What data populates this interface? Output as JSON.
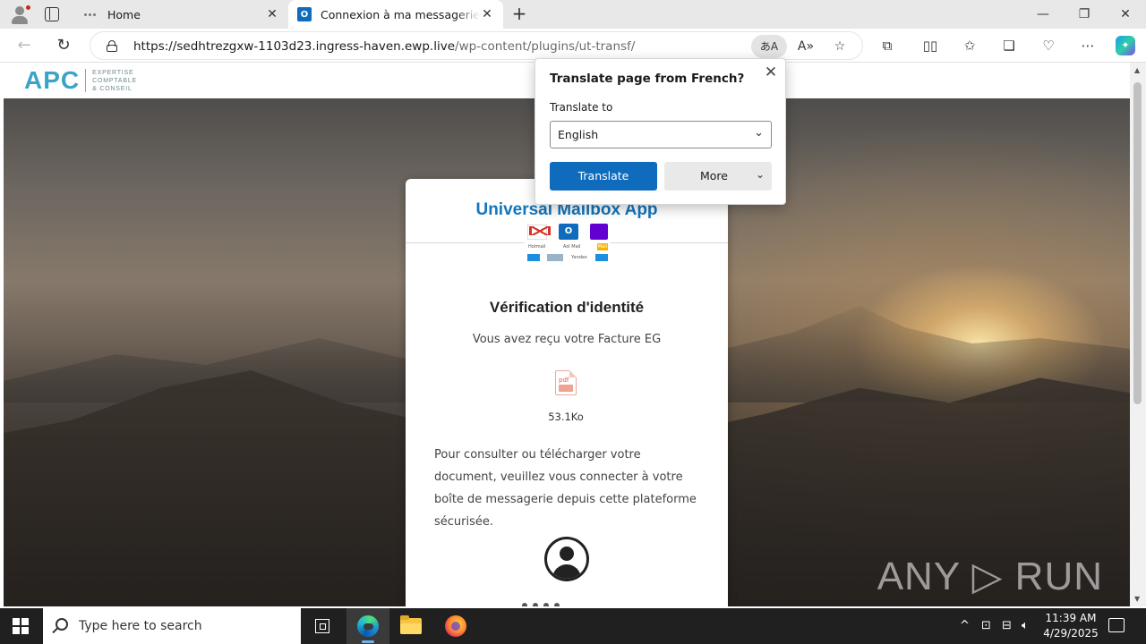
{
  "tabs": [
    {
      "title": "Home",
      "favicon": "dots-icon",
      "active": false
    },
    {
      "title": "Connexion à ma messagerie - Universal Mailbox App",
      "favicon": "outlook-icon",
      "favicon_letter": "O",
      "active": true
    }
  ],
  "window": {
    "minimize": "—",
    "maximize": "❐",
    "close": "✕"
  },
  "address_bar": {
    "url_host": "https://sedhtrezgxw-1103d23.ingress-haven.ewp.live",
    "url_path": "/wp-content/plugins/ut-transf/",
    "translate_glyph": "あA"
  },
  "site": {
    "logo_mark": "APC",
    "logo_sub": [
      "EXPERTISE",
      "COMPTABLE",
      "& CONSEIL"
    ]
  },
  "card": {
    "title": "Universal Mailbox App",
    "heading": "Vérification d'identité",
    "subtitle": "Vous avez reçu votre Facture EG",
    "file_icon_label": "pdf",
    "file_size": "53.1Ko",
    "description": "Pour consulter ou télécharger votre document, veuillez vous connecter à votre boîte de messagerie depuis cette plateforme sécurisée.",
    "providers_row2": [
      "Hotmail",
      "Aol Mail",
      "Mail"
    ],
    "providers_row3": [
      "Yandex"
    ]
  },
  "translate_popup": {
    "title": "Translate page from French?",
    "label": "Translate to",
    "selected_language": "English",
    "translate_button": "Translate",
    "more_button": "More"
  },
  "watermark": "ANY ▷ RUN",
  "taskbar": {
    "search_placeholder": "Type here to search",
    "time": "11:39 AM",
    "date": "4/29/2025"
  },
  "colors": {
    "accent": "#0f6cbd",
    "card_title": "#1376bd",
    "logo": "#3ba3c8"
  }
}
